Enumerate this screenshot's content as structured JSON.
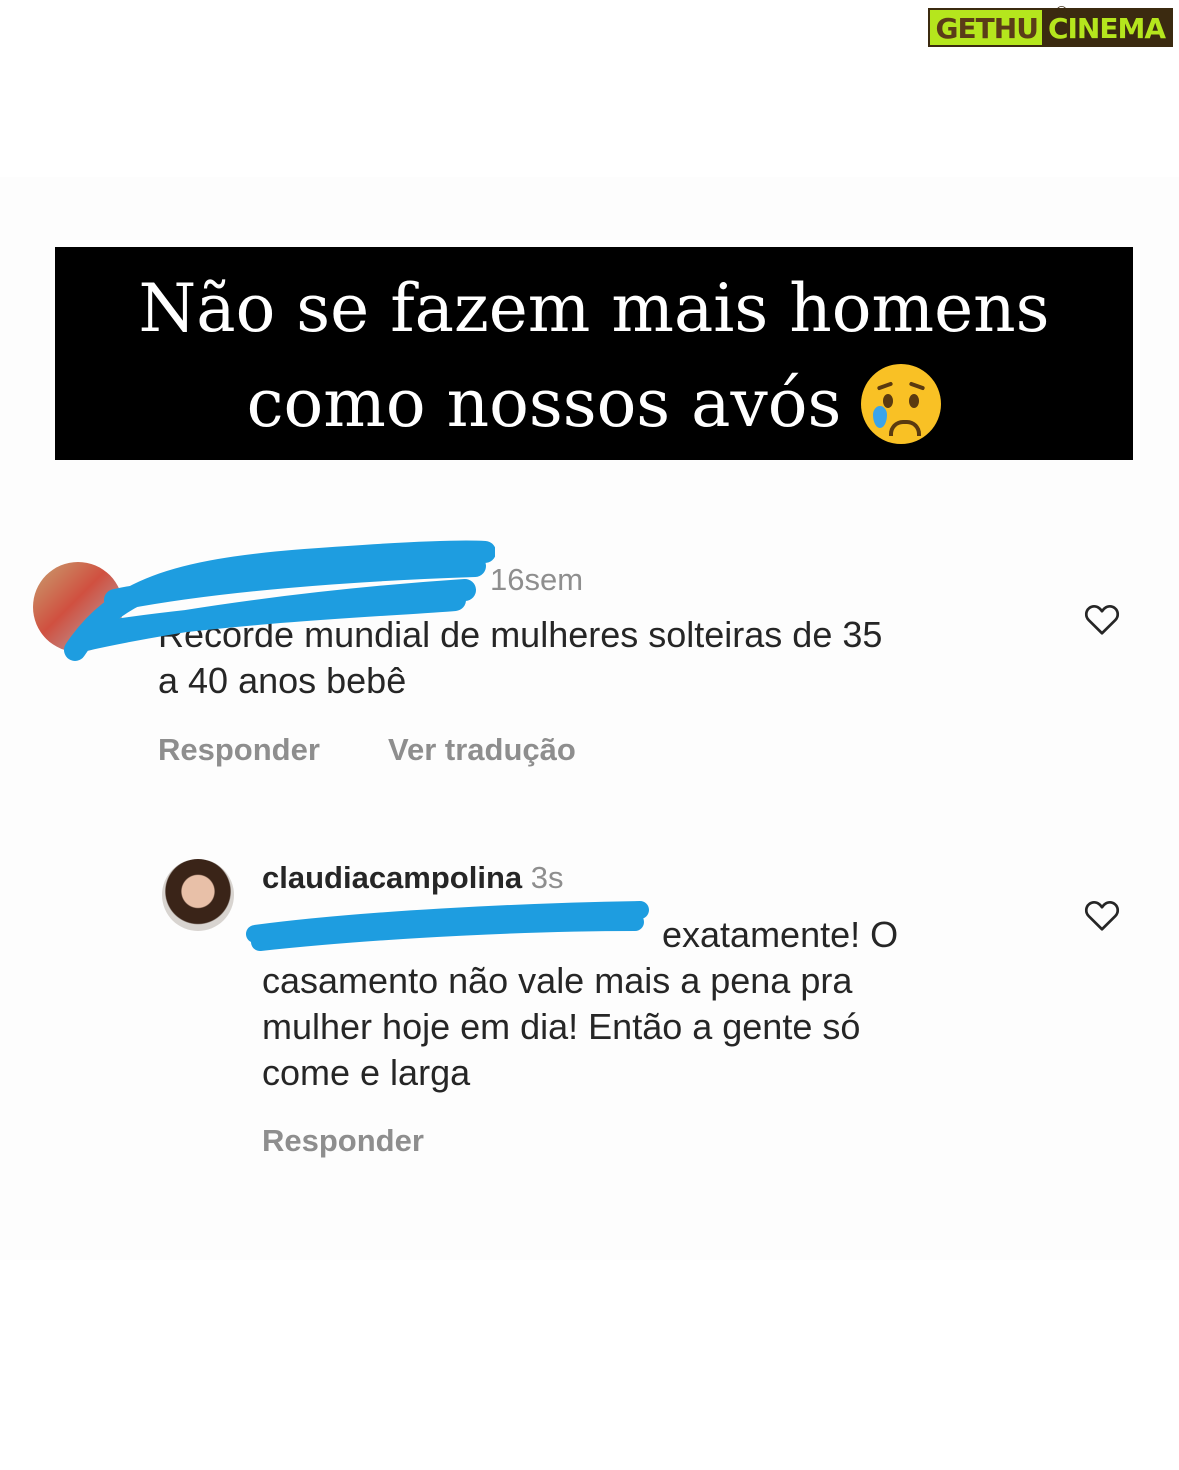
{
  "watermark": {
    "part1": "GETHU",
    "part2": "CINEMA"
  },
  "banner": {
    "line1": "Não se fazem mais homens",
    "line2": "como nossos avós"
  },
  "comments": [
    {
      "time": "16sem",
      "text_line1": "Recorde mundial de mulheres solteiras de 35",
      "text_line2": "a 40 anos bebê",
      "reply_label": "Responder",
      "translate_label": "Ver tradução"
    },
    {
      "username": "claudiacampolina",
      "time": "3s",
      "text_line1": "exatamente! O",
      "text_line2": "casamento não vale mais a pena pra",
      "text_line3": "mulher hoje em dia! Então a gente só",
      "text_line4": "come e larga",
      "reply_label": "Responder"
    }
  ],
  "colors": {
    "redaction": "#1e9de0",
    "secondary_text": "#8e8e8e",
    "primary_text": "#262626"
  },
  "icons": [
    "heart-icon",
    "crying-face-emoji"
  ]
}
